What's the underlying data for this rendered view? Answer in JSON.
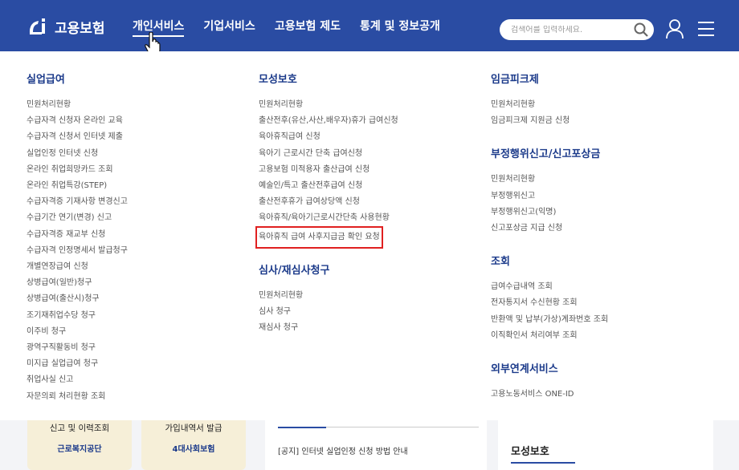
{
  "header": {
    "logo_text": "고용보험",
    "nav": [
      "개인서비스",
      "기업서비스",
      "고용보험 제도",
      "통계 및 정보공개"
    ],
    "search_placeholder": "검색어를 입력하세요."
  },
  "menu": {
    "col1": {
      "title": "실업급여",
      "links": [
        "민원처리현황",
        "수급자격 신청자 온라인 교육",
        "수급자격 신청서 인터넷 제출",
        "실업인정 인터넷 신청",
        "온라인 취업희망카드 조회",
        "온라인 취업특강(STEP)",
        "수급자격증 기재사항 변경신고",
        "수급기간 연기(변경) 신고",
        "수급자격증 재교부 신청",
        "수급자격 인정명세서 발급청구",
        "개별연장급여 신청",
        "상병급여(일반)청구",
        "상병급여(출산시)청구",
        "조기재취업수당 청구",
        "이주비 청구",
        "광역구직활동비 청구",
        "미지급 실업급여 청구",
        "취업사실 신고",
        "자문의뢰 처리현황 조회"
      ]
    },
    "col2": {
      "sections": [
        {
          "title": "모성보호",
          "links": [
            "민원처리현황",
            "출산전후(유산,사산,배우자)휴가 급여신청",
            "육아휴직급여 신청",
            "육아기 근로시간 단축 급여신청",
            "고용보험 미적용자 출산급여 신청",
            "예술인/특고 출산전후급여 신청",
            "출산전후휴가 급여상당액 신청",
            "육아휴직/육아기근로시간단축 사용현황",
            "육아휴직 급여 사후지급금 확인 요청"
          ]
        },
        {
          "title": "심사/재심사청구",
          "links": [
            "민원처리현황",
            "심사 청구",
            "재심사 청구"
          ]
        }
      ]
    },
    "col3": {
      "sections": [
        {
          "title": "임금피크제",
          "links": [
            "민원처리현황",
            "임금피크제 지원금 신청"
          ]
        },
        {
          "title": "부정행위신고/신고포상금",
          "links": [
            "민원처리현황",
            "부정행위신고",
            "부정행위신고(익명)",
            "신고포상금 지급 신청"
          ]
        },
        {
          "title": "조회",
          "links": [
            "급여수급내역 조회",
            "전자통지서 수신현황 조회",
            "반환액 및 납부(가상)계좌번호 조회",
            "이직확인서 처리여부 조회"
          ]
        },
        {
          "title": "외부연계서비스",
          "links": [
            "고용노동서비스 ONE-ID"
          ]
        }
      ]
    }
  },
  "below": {
    "card1_title": "신고 및 이력조회",
    "card1_sub": "근로복지공단",
    "card2_title": "가입내역서 발급",
    "card2_sub": "4대사회보험",
    "notice": "[공지] 인터넷 실업인정 신청 방법 안내",
    "right_title": "모성보호"
  },
  "colors": {
    "header": "#2a4ca3",
    "section_title": "#1b3a8a",
    "highlight": "#e02020"
  }
}
